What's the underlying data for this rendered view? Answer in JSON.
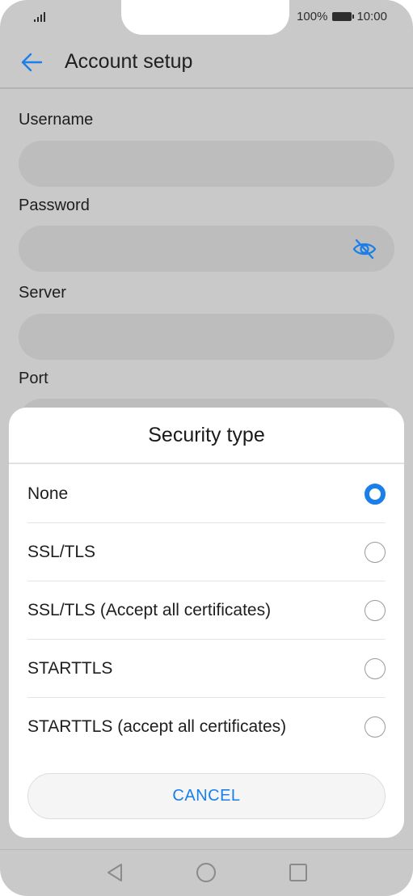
{
  "status_bar": {
    "battery_percent": "100%",
    "time": "10:00",
    "signal_icon": "signal-icon",
    "battery_icon": "battery-icon"
  },
  "header": {
    "title": "Account setup",
    "back_icon": "arrow-left-icon"
  },
  "form": {
    "username_label": "Username",
    "username_value": "",
    "password_label": "Password",
    "password_value": "",
    "password_toggle_icon": "eye-off-icon",
    "server_label": "Server",
    "server_value": "",
    "port_label": "Port"
  },
  "dialog": {
    "title": "Security type",
    "options": [
      {
        "label": "None",
        "selected": true
      },
      {
        "label": "SSL/TLS",
        "selected": false
      },
      {
        "label": "SSL/TLS (Accept all certificates)",
        "selected": false
      },
      {
        "label": "STARTTLS",
        "selected": false
      },
      {
        "label": "STARTTLS (accept all certificates)",
        "selected": false
      }
    ],
    "cancel_label": "CANCEL"
  },
  "nav_bar": {
    "back_icon": "triangle-back-icon",
    "home_icon": "circle-home-icon",
    "recents_icon": "square-recents-icon"
  },
  "colors": {
    "accent": "#1a7fe8",
    "scrim": "#c9c9c9",
    "field": "#bdbdbd"
  }
}
